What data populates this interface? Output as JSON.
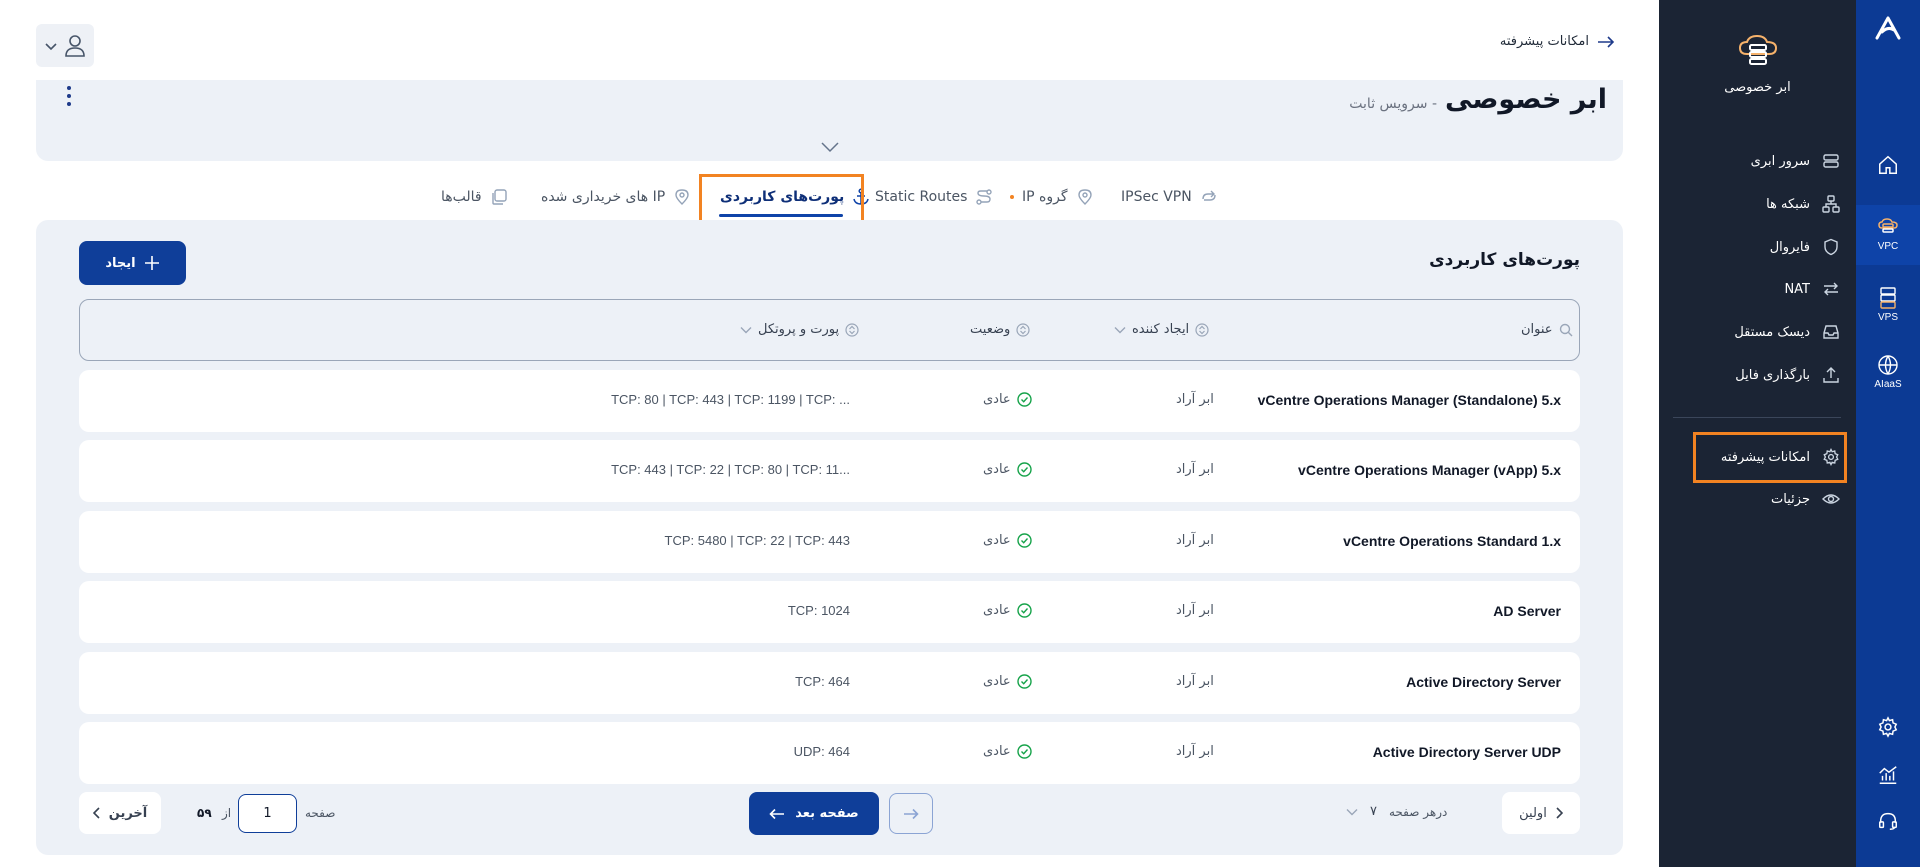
{
  "rail": {
    "items": [
      {
        "label": ""
      },
      {
        "label": "VPC"
      },
      {
        "label": "VPS"
      },
      {
        "label": "AIaaS"
      }
    ]
  },
  "sidebar": {
    "brand": "ابر خصوصی",
    "items": [
      {
        "label": "سرور ابری"
      },
      {
        "label": "شبکه ها"
      },
      {
        "label": "فایروال"
      },
      {
        "label": "NAT"
      },
      {
        "label": "دیسک مستقل"
      },
      {
        "label": "بارگذاری فایل"
      },
      {
        "label": "امکانات پیشرفته"
      },
      {
        "label": "جزئیات"
      }
    ]
  },
  "header": {
    "breadcrumb": "امکانات پیشرفته",
    "title": "ابر خصوصی",
    "subtitle": "- سرویس ثابت"
  },
  "tabs": [
    {
      "label": "IPSec VPN"
    },
    {
      "label": "گروه IP"
    },
    {
      "label": "Static Routes"
    },
    {
      "label": "پورت‌های کاربردی"
    },
    {
      "label": "IP های خریداری شده"
    },
    {
      "label": "قالب‌ها"
    }
  ],
  "section": {
    "title": "پورت‌های کاربردی",
    "create_label": "ایجاد"
  },
  "table": {
    "columns": {
      "title": "عنوان",
      "creator": "ایجاد کننده",
      "status": "وضعیت",
      "ports": "پورت و پروتکل"
    },
    "rows": [
      {
        "title": "vCentre Operations Manager (Standalone) 5.x",
        "creator": "ابر آراد",
        "status": "عادی",
        "ports": "TCP: 80 | TCP: 443 | TCP: 1199 | TCP: ..."
      },
      {
        "title": "vCentre Operations Manager (vApp) 5.x",
        "creator": "ابر آراد",
        "status": "عادی",
        "ports": "TCP: 443 | TCP: 22 | TCP: 80 | TCP: 11..."
      },
      {
        "title": "vCentre Operations Standard 1.x",
        "creator": "ابر آراد",
        "status": "عادی",
        "ports": "TCP: 5480 | TCP: 22 | TCP: 443"
      },
      {
        "title": "AD Server",
        "creator": "ابر آراد",
        "status": "عادی",
        "ports": "TCP: 1024"
      },
      {
        "title": "Active Directory Server",
        "creator": "ابر آراد",
        "status": "عادی",
        "ports": "TCP: 464"
      },
      {
        "title": "Active Directory Server UDP",
        "creator": "ابر آراد",
        "status": "عادی",
        "ports": "UDP: 464"
      }
    ]
  },
  "pagination": {
    "first_label": "اولین",
    "last_label": "آخرین",
    "per_page_label": "درهر صفحه",
    "per_page_value": "۷",
    "page_label": "صفحه",
    "of_label": "از",
    "total_pages": "۵۹",
    "current_page": "1",
    "next_label": "صفحه بعد"
  }
}
